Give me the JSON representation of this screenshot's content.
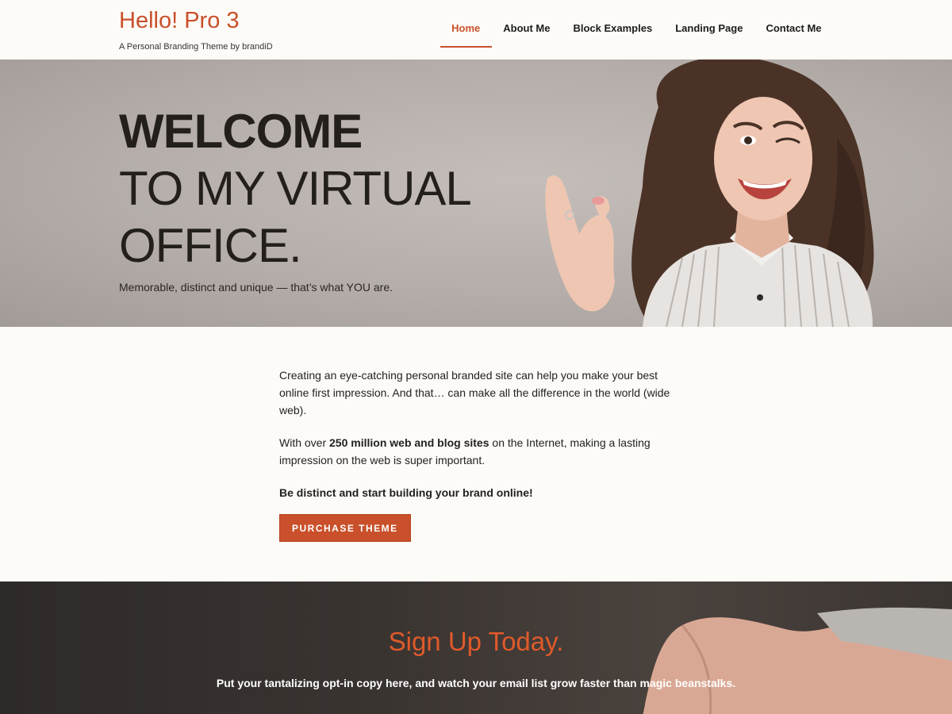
{
  "header": {
    "site_title": "Hello! Pro 3",
    "tagline": "A Personal Branding Theme by brandiD",
    "nav": [
      {
        "label": "Home",
        "active": true
      },
      {
        "label": "About Me"
      },
      {
        "label": "Block Examples"
      },
      {
        "label": "Landing Page"
      },
      {
        "label": "Contact Me"
      }
    ]
  },
  "hero": {
    "line1": "WELCOME",
    "line2": "TO MY VIRTUAL",
    "line3": "OFFICE.",
    "subtitle": "Memorable, distinct and unique — that’s what YOU are."
  },
  "content": {
    "p1": "Creating an eye-catching personal branded site can help you make your best online first impression. And that… can make all the difference in the world (wide web).",
    "p2_before": "With over ",
    "p2_bold": "250 million web and blog sites",
    "p2_after": " on the Internet, making a lasting impression on the web is super important.",
    "p3": "Be distinct and start building your brand online!",
    "button": "Purchase Theme"
  },
  "signup": {
    "title": "Sign Up Today.",
    "text": "Put your tantalizing opt-in copy here, and watch your email list grow faster than magic beanstalks."
  },
  "colors": {
    "accent": "#c9502a",
    "background": "#fdfbf7",
    "signup_title": "#e05a2a"
  }
}
